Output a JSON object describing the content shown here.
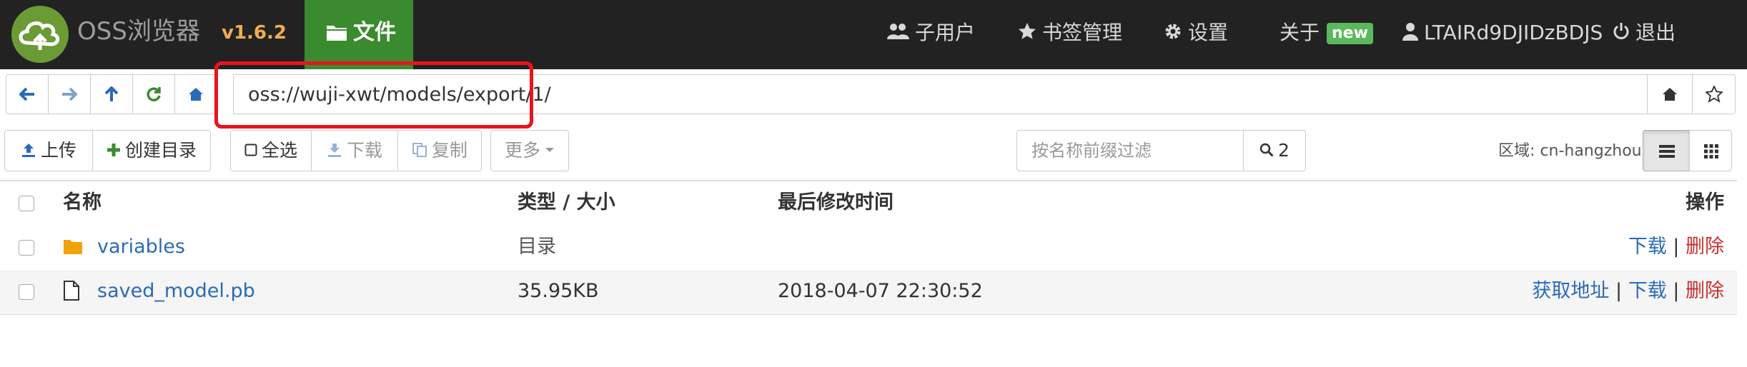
{
  "navbar": {
    "brand": "OSS浏览器",
    "version": "v1.6.2",
    "files_tab": "文件",
    "items": {
      "subusers": "子用户",
      "bookmarks": "书签管理",
      "settings": "设置",
      "about": "关于",
      "about_badge": "new",
      "account": "LTAIRd9DJIDzBDJS",
      "logout": "退出"
    }
  },
  "address": {
    "path": "oss://wuji-xwt/models/export/1/"
  },
  "toolbar": {
    "upload": "上传",
    "mkdir": "创建目录",
    "select_all": "全选",
    "download": "下载",
    "copy": "复制",
    "more": "更多",
    "filter_placeholder": "按名称前缀过滤",
    "search_count": "2",
    "region": "区域: cn-hangzhou"
  },
  "table": {
    "headers": {
      "name": "名称",
      "type_size": "类型 / 大小",
      "modified": "最后修改时间",
      "actions": "操作"
    },
    "rows": [
      {
        "name": "variables",
        "type_size": "目录",
        "modified": "",
        "icon": "folder-icon",
        "actions": {
          "download": "下载",
          "delete": "删除"
        }
      },
      {
        "name": "saved_model.pb",
        "type_size": "35.95KB",
        "modified": "2018-04-07 22:30:52",
        "icon": "file-icon",
        "actions": {
          "get_url": "获取地址",
          "download": "下载",
          "delete": "删除"
        }
      }
    ],
    "separator": "|"
  },
  "colors": {
    "navbar_bg": "#222222",
    "files_tab_bg": "#3a8b2f",
    "version": "#f0ad4e",
    "badge_new": "#5cb85c",
    "link": "#2a6bb7",
    "danger": "#c9302c",
    "highlight_box": "#e8141c"
  }
}
